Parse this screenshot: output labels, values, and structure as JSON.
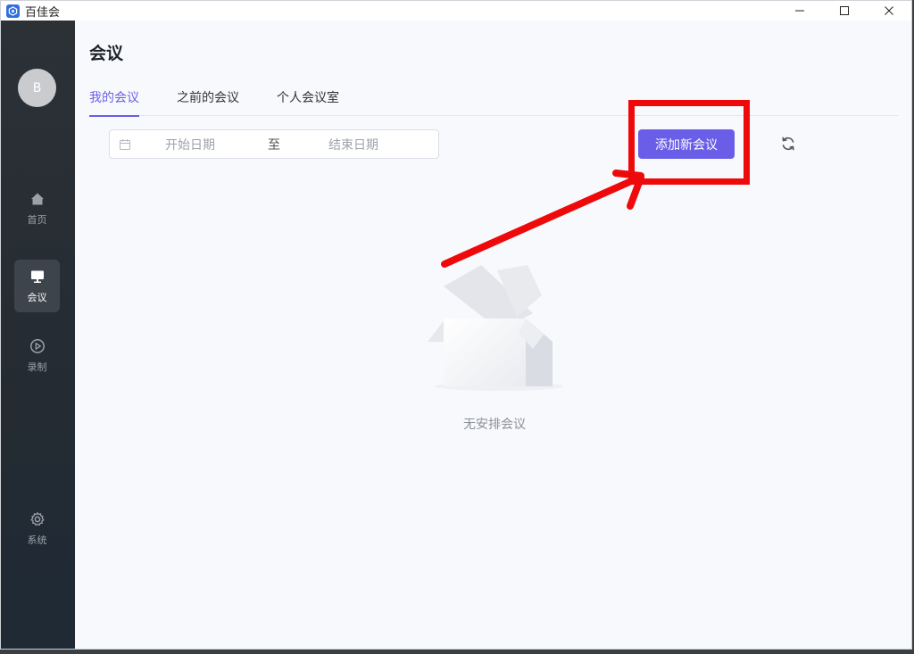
{
  "window": {
    "title": "百佳会",
    "controls": [
      "minimize",
      "maximize",
      "close"
    ]
  },
  "sidebar": {
    "avatar_initial": "B",
    "items": [
      {
        "label": "首页",
        "icon": "home-icon",
        "active": false
      },
      {
        "label": "会议",
        "icon": "monitor-icon",
        "active": true
      },
      {
        "label": "录制",
        "icon": "play-circle-icon",
        "active": false
      },
      {
        "label": "系统",
        "icon": "gear-icon",
        "active": false
      }
    ]
  },
  "main": {
    "page_title": "会议",
    "tabs": [
      {
        "label": "我的会议",
        "active": true
      },
      {
        "label": "之前的会议",
        "active": false
      },
      {
        "label": "个人会议室",
        "active": false
      }
    ],
    "date_range": {
      "start_placeholder": "开始日期",
      "separator": "至",
      "end_placeholder": "结束日期"
    },
    "add_button_label": "添加新会议",
    "empty_state_text": "无安排会议"
  },
  "colors": {
    "accent": "#6a5ee8",
    "annotation_red": "#ee0a0a",
    "sidebar_bg": "#262c33"
  }
}
